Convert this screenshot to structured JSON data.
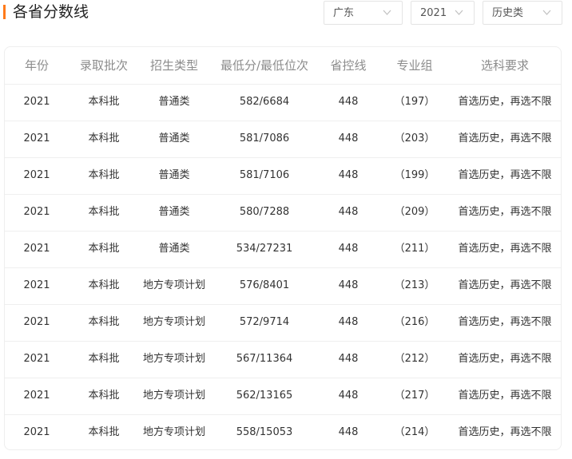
{
  "page": {
    "title": "各省分数线"
  },
  "filters": {
    "province": "广东",
    "year": "2021",
    "subject_type": "历史类",
    "chevron_icon": "chevron-down-icon"
  },
  "table": {
    "headers": [
      "年份",
      "录取批次",
      "招生类型",
      "最低分/最低位次",
      "省控线",
      "专业组",
      "选科要求"
    ],
    "rows": [
      [
        "2021",
        "本科批",
        "普通类",
        "582/6684",
        "448",
        "（197）",
        "首选历史，再选不限"
      ],
      [
        "2021",
        "本科批",
        "普通类",
        "581/7086",
        "448",
        "（203）",
        "首选历史，再选不限"
      ],
      [
        "2021",
        "本科批",
        "普通类",
        "581/7106",
        "448",
        "（199）",
        "首选历史，再选不限"
      ],
      [
        "2021",
        "本科批",
        "普通类",
        "580/7288",
        "448",
        "（209）",
        "首选历史，再选不限"
      ],
      [
        "2021",
        "本科批",
        "普通类",
        "534/27231",
        "448",
        "（211）",
        "首选历史，再选不限"
      ],
      [
        "2021",
        "本科批",
        "地方专项计划",
        "576/8401",
        "448",
        "（213）",
        "首选历史，再选不限"
      ],
      [
        "2021",
        "本科批",
        "地方专项计划",
        "572/9714",
        "448",
        "（216）",
        "首选历史，再选不限"
      ],
      [
        "2021",
        "本科批",
        "地方专项计划",
        "567/11364",
        "448",
        "（212）",
        "首选历史，再选不限"
      ],
      [
        "2021",
        "本科批",
        "地方专项计划",
        "562/13165",
        "448",
        "（217）",
        "首选历史，再选不限"
      ],
      [
        "2021",
        "本科批",
        "地方专项计划",
        "558/15053",
        "448",
        "（214）",
        "首选历史，再选不限"
      ]
    ]
  },
  "colors": {
    "accent": "#ff7a1a",
    "header_text": "#8c8c8c",
    "cell_text": "#333333",
    "border": "#efefef"
  }
}
